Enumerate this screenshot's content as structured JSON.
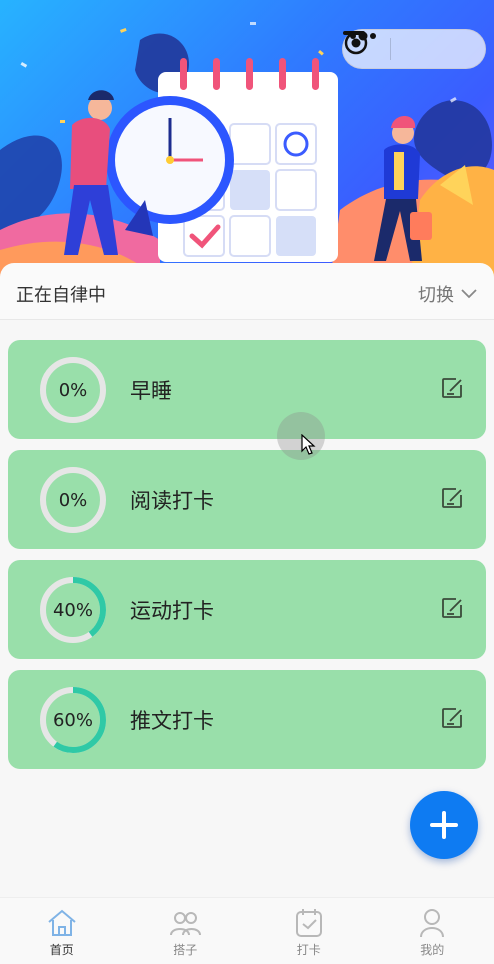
{
  "colors": {
    "card_bg": "#99dfaa",
    "ring_track": "#e6e6e6",
    "ring_progress": "#2fc9a6",
    "fab": "#0e7bf2",
    "tab_active_icon": "#7fb3e6",
    "tab_inactive_icon": "#b8b8b8"
  },
  "capsule": {
    "more_icon": "more-dots-icon",
    "minimize_icon": "minimize-icon",
    "close_icon": "target-close-icon"
  },
  "status": {
    "title": "正在自律中",
    "switch_label": "切换"
  },
  "tasks": [
    {
      "name": "早睡",
      "progress_label": "0%",
      "progress": 0
    },
    {
      "name": "阅读打卡",
      "progress_label": "0%",
      "progress": 0
    },
    {
      "name": "运动打卡",
      "progress_label": "40%",
      "progress": 0.4
    },
    {
      "name": "推文打卡",
      "progress_label": "60%",
      "progress": 0.6
    }
  ],
  "fab": {
    "icon": "plus-icon"
  },
  "tabbar": {
    "items": [
      {
        "label": "首页",
        "icon": "home-icon",
        "active": true
      },
      {
        "label": "搭子",
        "icon": "partners-icon",
        "active": false
      },
      {
        "label": "打卡",
        "icon": "checkin-calendar-icon",
        "active": false
      },
      {
        "label": "我的",
        "icon": "profile-icon",
        "active": false
      }
    ]
  }
}
